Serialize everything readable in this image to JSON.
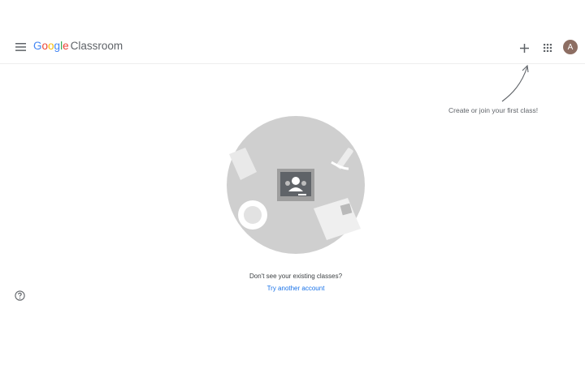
{
  "header": {
    "logo_letters": [
      "G",
      "o",
      "o",
      "g",
      "l",
      "e"
    ],
    "logo_colors": [
      "#4285F4",
      "#EA4335",
      "#FBBC05",
      "#4285F4",
      "#34A853",
      "#EA4335"
    ],
    "product_name": "Classroom",
    "menu_icon": "hamburger-menu-icon",
    "create_icon": "plus-icon",
    "apps_icon": "apps-grid-icon",
    "avatar_initial": "A",
    "avatar_color": "#8d6e63"
  },
  "hint": {
    "text": "Create or join your first class!",
    "icon": "curved-arrow-icon"
  },
  "empty_state": {
    "illustration_icon": "classroom-illustration",
    "prompt": "Don't see your existing classes?",
    "link_label": "Try another account",
    "link_color": "#1a73e8"
  },
  "footer": {
    "help_icon": "help-circle-icon"
  }
}
